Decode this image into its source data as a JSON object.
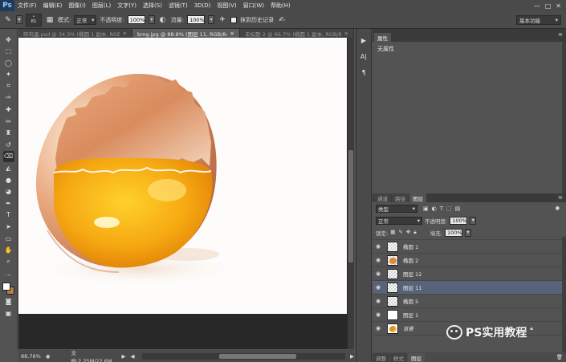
{
  "app": {
    "logo": "Ps",
    "menu": [
      "文件(F)",
      "编辑(E)",
      "图像(I)",
      "图层(L)",
      "文字(Y)",
      "选择(S)",
      "滤镜(T)",
      "3D(D)",
      "视图(V)",
      "窗口(W)",
      "帮助(H)"
    ],
    "window_controls": [
      "—",
      "□",
      "✕"
    ]
  },
  "options": {
    "brush_size": "81",
    "mode_label": "模式:",
    "mode_value": "正常",
    "opacity_label": "不透明度:",
    "opacity_value": "100%",
    "flow_label": "流量:",
    "flow_value": "100%",
    "history_label": "抹到历史记录",
    "workspace": "基本功能"
  },
  "tabs": [
    {
      "label": "碎鸡蛋.psd @ 34.3% (椭圆 1 副本, RGB/8...",
      "active": false
    },
    {
      "label": "bmg.jpg @ 88.8% (图层 11, RGB/8#) *",
      "active": true
    },
    {
      "label": "未标题-2 @ 66.7% (椭圆 1 副本, RGB/8...",
      "active": false
    }
  ],
  "status": {
    "zoom": "88.76%",
    "doc": "文档:2.25M/22.6M"
  },
  "properties": {
    "tab_label": "属性",
    "body_text": "无属性"
  },
  "layers_panel": {
    "tabs": [
      "通道",
      "路径",
      "图层"
    ],
    "active_tab": 2,
    "filter_kind": "类型",
    "blend_mode": "正常",
    "opacity_label": "不透明度:",
    "opacity_value": "100%",
    "lock_label": "锁定:",
    "fill_label": "填充:",
    "fill_value": "100%",
    "layers": [
      {
        "name": "椭圆 1",
        "thumb": "checker",
        "selected": false
      },
      {
        "name": "椭圆 2",
        "thumb": "egg",
        "selected": false
      },
      {
        "name": "图层 12",
        "thumb": "checker",
        "selected": false
      },
      {
        "name": "图层 11",
        "thumb": "checker",
        "selected": true
      },
      {
        "name": "椭圆 5",
        "thumb": "checker",
        "selected": false
      },
      {
        "name": "图层 1",
        "thumb": "white",
        "selected": false
      },
      {
        "name": "背景",
        "thumb": "bg",
        "selected": false
      }
    ],
    "bottom_tabs": [
      "调整",
      "样式",
      "图层"
    ]
  },
  "watermark": "PS实用教程",
  "colors": {
    "foreground": "#ffffff",
    "background": "#b5804a",
    "selected_layer": "#58637a"
  }
}
